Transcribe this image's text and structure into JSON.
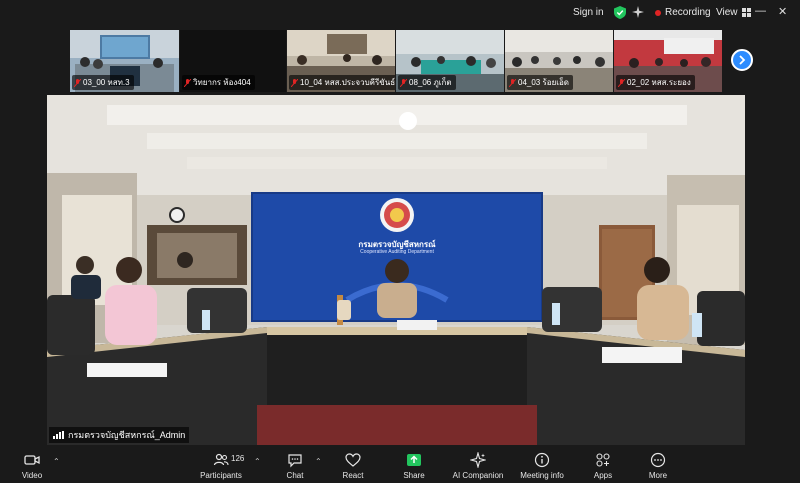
{
  "topbar": {
    "signin": "Sign in",
    "recording": "Recording",
    "view": "View"
  },
  "thumbnails": [
    {
      "label": "03_00 หสท.3"
    },
    {
      "label": "วิทยากร ห้อง404"
    },
    {
      "label": "10_04 หสส.ประจวบคีรีขันธ์"
    },
    {
      "label": "08_06 ภูเก็ต"
    },
    {
      "label": "04_03 ร้อยเอ็ด"
    },
    {
      "label": "02_02 หสส.ระยอง"
    }
  ],
  "main_video": {
    "participant_name": "กรมตรวจบัญชีสหกรณ์_Admin",
    "banner_title": "กรมตรวจบัญชีสหกรณ์",
    "banner_subtitle": "Cooperative Auditing Department"
  },
  "toolbar": {
    "video": "Video",
    "participants": "Participants",
    "participant_count": "126",
    "chat": "Chat",
    "react": "React",
    "share": "Share",
    "ai_companion": "AI Companion",
    "meeting_info": "Meeting info",
    "apps": "Apps",
    "more": "More"
  },
  "colors": {
    "background": "#1a1a1a",
    "share_accent": "#22c55e",
    "recording_dot": "#e02424",
    "shield": "#22c55e",
    "strip_next": "#2d8cff"
  }
}
